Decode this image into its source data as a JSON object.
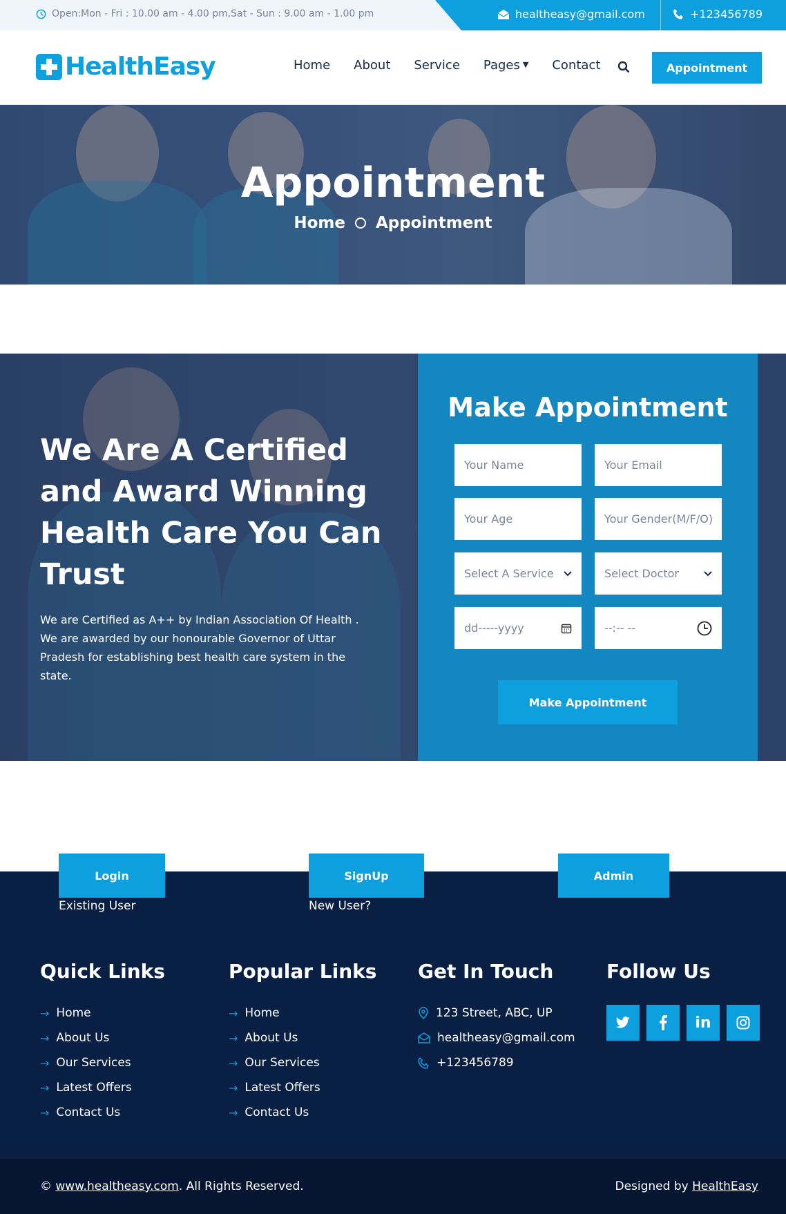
{
  "topbar": {
    "hours": "Open:Mon - Fri : 10.00 am - 4.00 pm,Sat - Sun : 9.00 am - 1.00 pm",
    "email": "healtheasy@gmail.com",
    "phone": "+123456789"
  },
  "brand": {
    "name": "HealthEasy",
    "accent": "#0d9fde"
  },
  "nav": {
    "items": [
      "Home",
      "About",
      "Service",
      "Pages",
      "Contact"
    ],
    "cta": "Appointment"
  },
  "hero": {
    "title": "Appointment",
    "breadcrumb": [
      "Home",
      "Appointment"
    ]
  },
  "about": {
    "heading": "We Are A Certified and Award Winning Health Care You Can Trust",
    "text": "We are Certified as A++ by Indian Association Of Health . We are awarded by our honourable Governor of Uttar Pradesh for establishing best health care system in the state."
  },
  "form": {
    "title": "Make Appointment",
    "fields": {
      "name": "Your Name",
      "email": "Your Email",
      "age": "Your Age",
      "gender": "Your Gender(M/F/O)",
      "service": "Select A Service",
      "doctor": "Select Doctor",
      "date": "dd-----yyyy",
      "time": "--:-- --"
    },
    "submit": "Make Appointment"
  },
  "auth": {
    "login": "Login",
    "login_label": "Existing User",
    "signup": "SignUp",
    "signup_label": "New User?",
    "admin": "Admin"
  },
  "footer": {
    "quick_title": "Quick Links",
    "quick": [
      "Home",
      "About Us",
      "Our Services",
      "Latest Offers",
      "Contact Us"
    ],
    "popular_title": "Popular Links",
    "popular": [
      "Home",
      "About Us",
      "Our Services",
      "Latest Offers",
      "Contact Us"
    ],
    "touch_title": "Get In Touch",
    "address": "123 Street, ABC, UP",
    "email": "healtheasy@gmail.com",
    "phone": "+123456789",
    "follow_title": "Follow Us",
    "social": [
      "twitter-icon",
      "facebook-icon",
      "linkedin-icon",
      "instagram-icon"
    ]
  },
  "bottom": {
    "copy_prefix": "©",
    "site": "www.healtheasy.com",
    "copy_suffix": ". All Rights Reserved.",
    "designed": "Designed by",
    "designer": "HealthEasy"
  }
}
